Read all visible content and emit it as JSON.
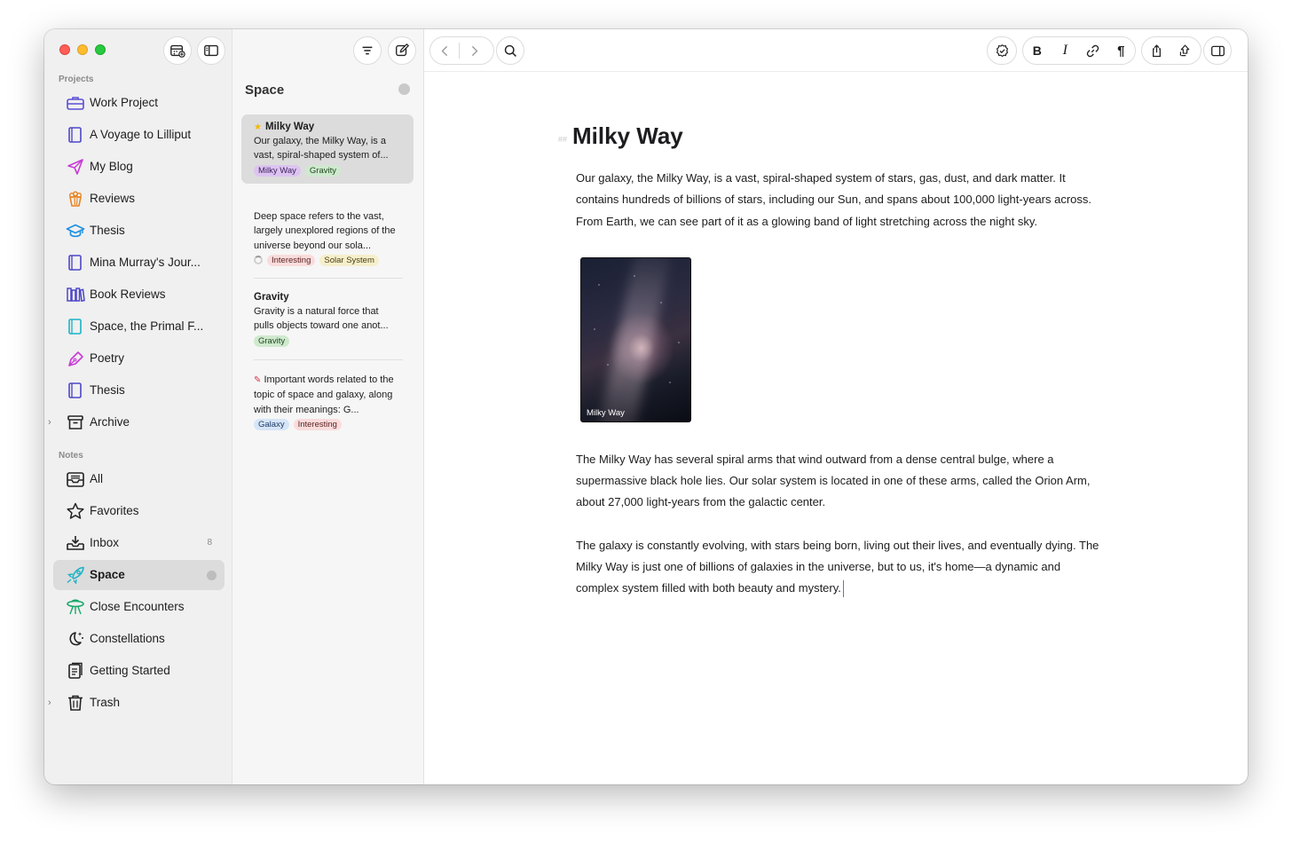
{
  "sidebar": {
    "projects_title": "Projects",
    "notes_title": "Notes",
    "projects": [
      {
        "label": "Work Project",
        "icon": "briefcase-icon"
      },
      {
        "label": "A Voyage to Lilliput",
        "icon": "book-icon"
      },
      {
        "label": "My Blog",
        "icon": "paper-plane-icon"
      },
      {
        "label": "Reviews",
        "icon": "popcorn-icon"
      },
      {
        "label": "Thesis",
        "icon": "graduation-cap-icon"
      },
      {
        "label": "Mina Murray's Jour...",
        "icon": "book-icon"
      },
      {
        "label": "Book Reviews",
        "icon": "books-icon"
      },
      {
        "label": "Space, the Primal F...",
        "icon": "book-icon"
      },
      {
        "label": "Poetry",
        "icon": "fountain-pen-icon"
      },
      {
        "label": "Thesis",
        "icon": "book-icon"
      },
      {
        "label": "Archive",
        "icon": "archive-box-icon"
      }
    ],
    "notes": [
      {
        "label": "All",
        "icon": "tray-icon"
      },
      {
        "label": "Favorites",
        "icon": "star-icon"
      },
      {
        "label": "Inbox",
        "icon": "inbox-icon",
        "count": "8"
      },
      {
        "label": "Space",
        "icon": "rocket-icon"
      },
      {
        "label": "Close Encounters",
        "icon": "ufo-icon"
      },
      {
        "label": "Constellations",
        "icon": "moon-stars-icon"
      },
      {
        "label": "Getting Started",
        "icon": "document-icon"
      },
      {
        "label": "Trash",
        "icon": "trash-icon"
      }
    ]
  },
  "notelist": {
    "title": "Space",
    "cards": [
      {
        "title": "Milky Way",
        "body": "Our galaxy, the Milky Way, is a vast, spiral-shaped system of...",
        "tags": [
          {
            "label": "Milky Way",
            "color": "purple"
          },
          {
            "label": "Gravity",
            "color": "green"
          }
        ]
      },
      {
        "title": "",
        "body": "Deep space refers to the vast, largely unexplored regions of the universe beyond our sola...",
        "tags": [
          {
            "label": "Interesting",
            "color": "pink"
          },
          {
            "label": "Solar System",
            "color": "yellow"
          }
        ]
      },
      {
        "title": "Gravity",
        "body": "Gravity is a natural force that pulls objects toward one anot...",
        "tags": [
          {
            "label": "Gravity",
            "color": "green"
          }
        ]
      },
      {
        "title": "",
        "body": "Important words related to the topic of space and galaxy, along with their meanings: G...",
        "tags": [
          {
            "label": "Galaxy",
            "color": "blue"
          },
          {
            "label": "Interesting",
            "color": "pink"
          }
        ]
      }
    ]
  },
  "editor": {
    "heading_marker": "##",
    "heading": "Milky Way",
    "paragraph1": "Our galaxy, the Milky Way, is a vast, spiral-shaped system of stars, gas, dust, and dark matter. It contains hundreds of billions of stars, including our Sun, and spans about 100,000 light-years across. From Earth, we can see part of it as a glowing band of light stretching across the night sky.",
    "image_caption": "Milky Way",
    "paragraph2": "The Milky Way has several spiral arms that wind outward from a dense central bulge, where a supermassive black hole lies. Our solar system is located in one of these arms, called the Orion Arm, about 27,000 light-years from the galactic center.",
    "paragraph3": "The galaxy is constantly evolving, with stars being born, living out their lives, and eventually dying. The Milky Way is just one of billions of galaxies in the universe, but to us, it's home—a dynamic and complex system filled with both beauty and mystery."
  },
  "colors": {
    "accent": "#3b5bdb",
    "traffic_red": "#ff5f57",
    "traffic_yellow": "#febc2e",
    "traffic_green": "#28c840"
  }
}
